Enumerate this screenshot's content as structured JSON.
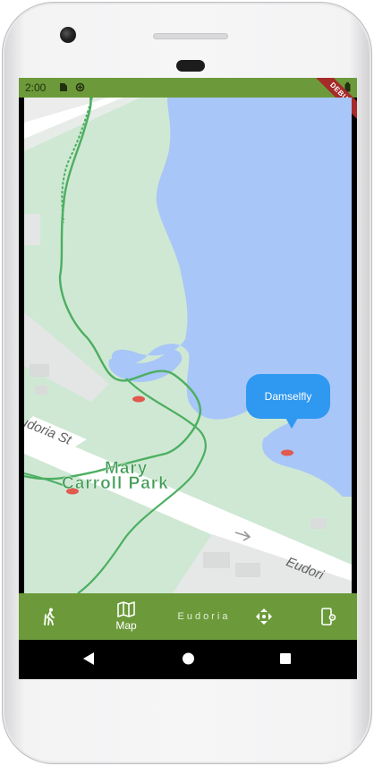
{
  "status_bar": {
    "time": "2:00",
    "icons": [
      "sim-card-icon",
      "data-saver-icon",
      "battery-icon"
    ],
    "debug_banner": "DEBUG",
    "color": "#6c9a3a"
  },
  "map": {
    "park_label_line1": "Mary",
    "park_label_line2": "Carroll Park",
    "street_label_1": "udoria St",
    "street_label_2": "Eudori",
    "water_color": "#a8c6f7",
    "park_color": "#cfe8d4",
    "trail_color": "#4caf60",
    "marker_bubble": {
      "label": "Damselfly",
      "color": "#2f98f0"
    }
  },
  "bottom_nav": {
    "items": [
      {
        "icon": "hiking-icon",
        "label": ""
      },
      {
        "icon": "map-icon",
        "label": "Map"
      },
      {
        "icon": "",
        "label": "Eudoria"
      },
      {
        "icon": "directions-icon",
        "label": ""
      },
      {
        "icon": "phone-settings-icon",
        "label": ""
      }
    ],
    "color": "#6c9a3a"
  },
  "system_nav": {
    "buttons": [
      "back-icon",
      "home-icon",
      "recents-icon"
    ]
  }
}
